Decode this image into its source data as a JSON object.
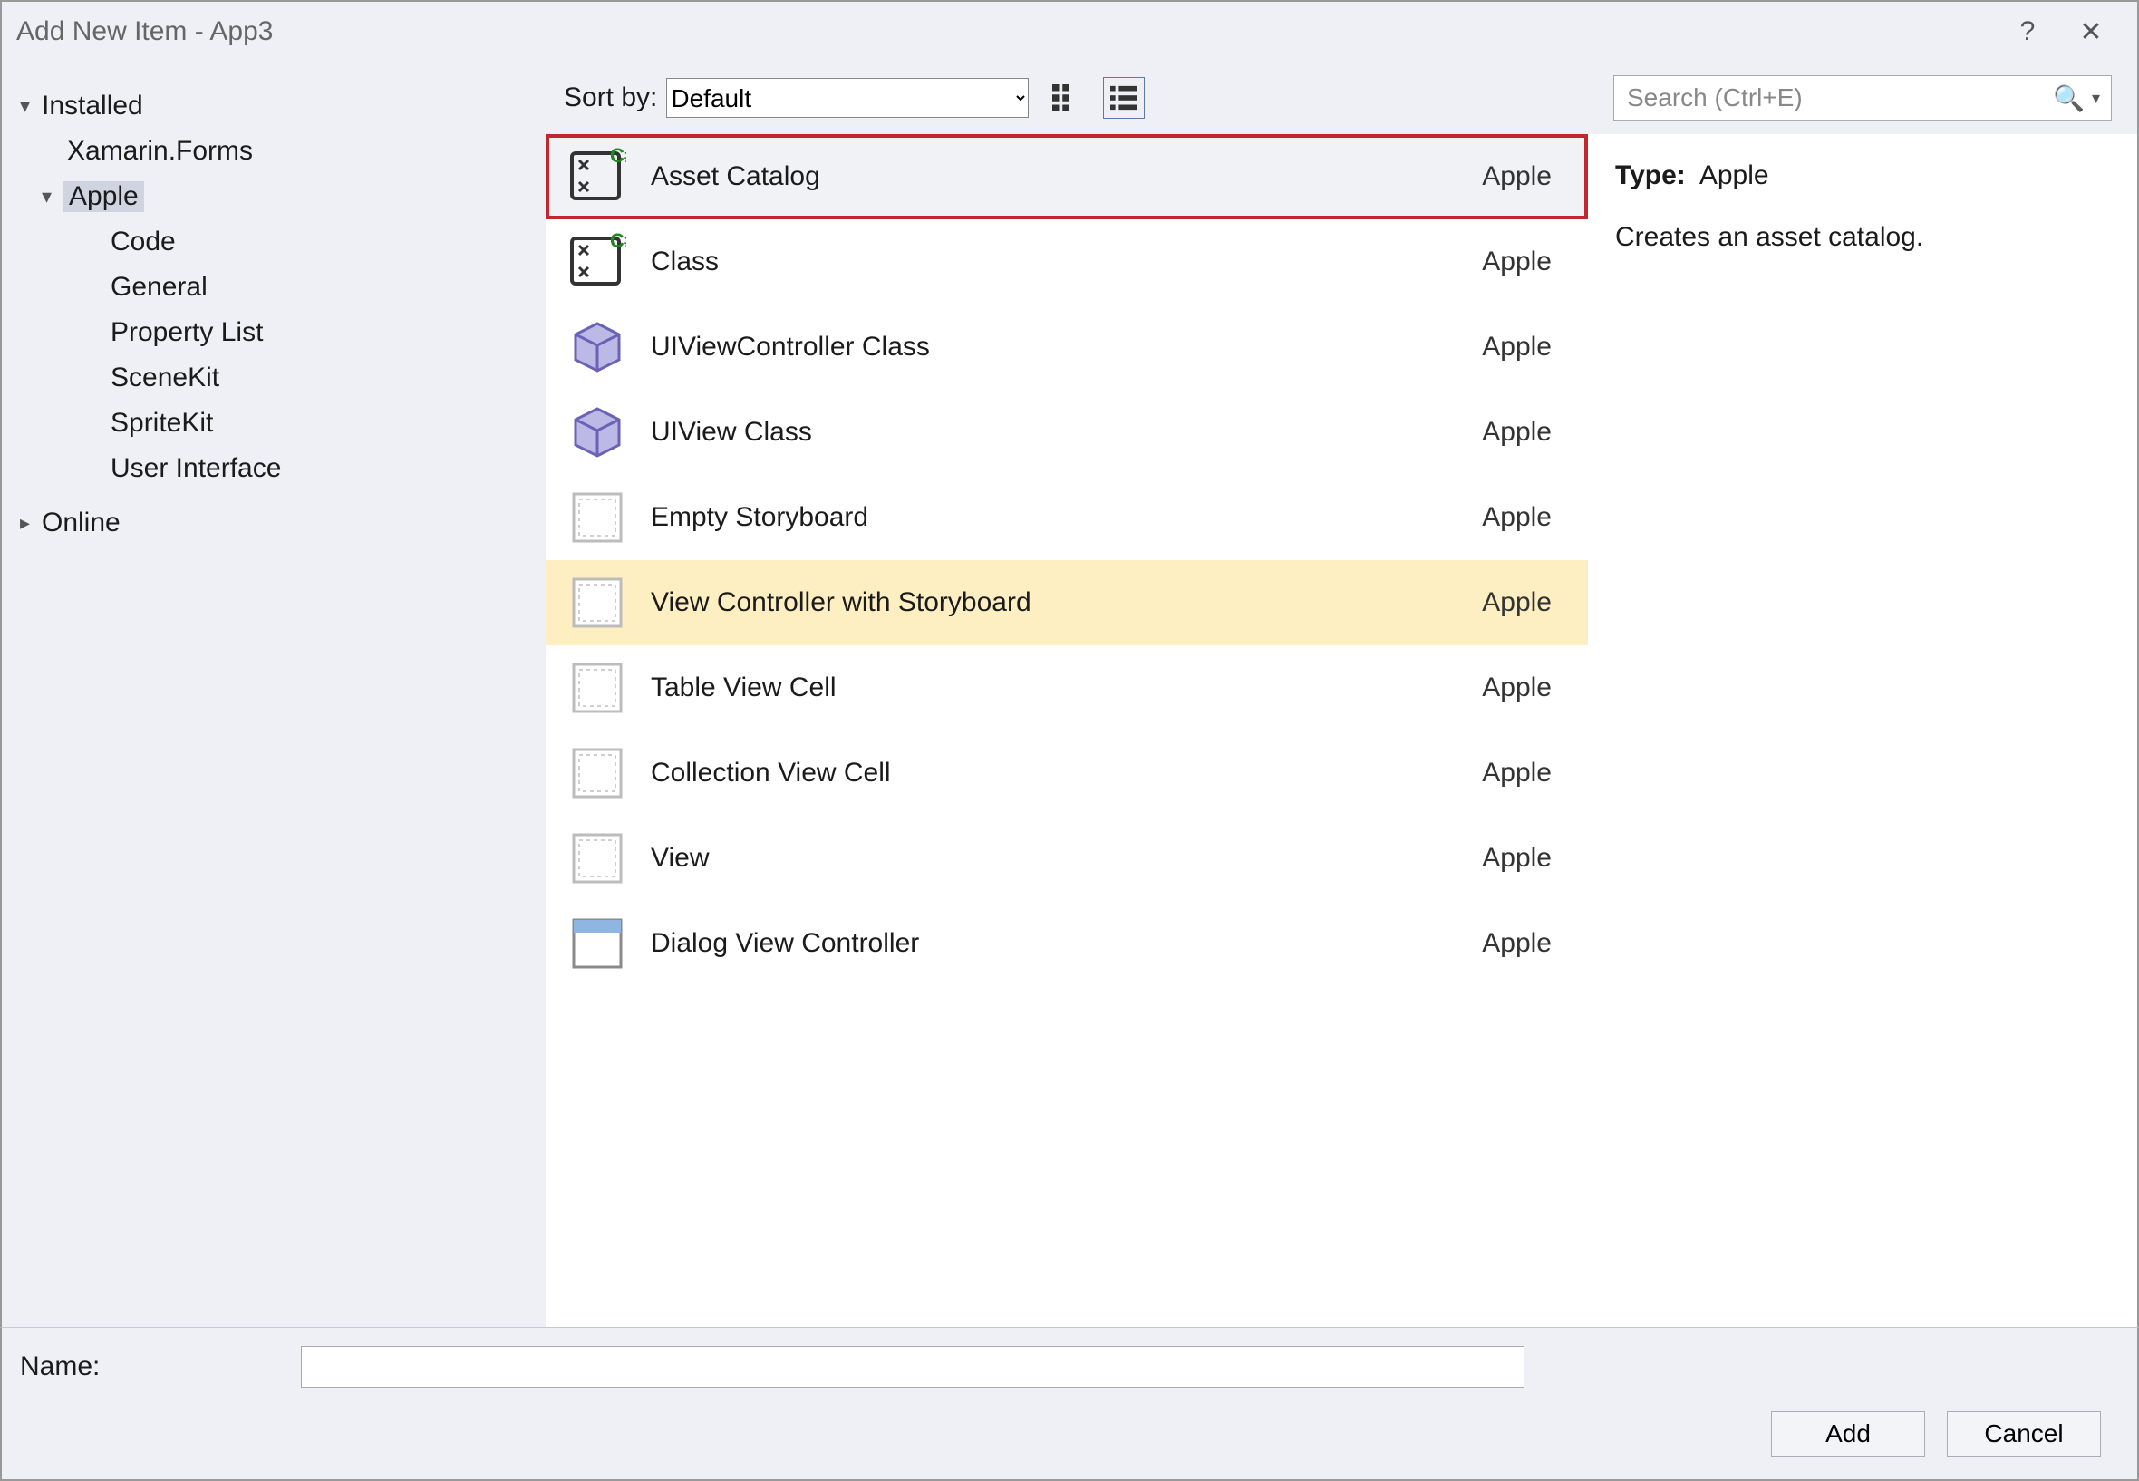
{
  "window": {
    "title": "Add New Item - App3"
  },
  "sidebar": {
    "installed_label": "Installed",
    "xamarin_forms": "Xamarin.Forms",
    "apple": "Apple",
    "apple_children": {
      "code": "Code",
      "general": "General",
      "property_list": "Property List",
      "scenekit": "SceneKit",
      "spritekit": "SpriteKit",
      "user_interface": "User Interface"
    },
    "online_label": "Online"
  },
  "toolbar": {
    "sort_label": "Sort by:",
    "sort_value": "Default"
  },
  "templates": [
    {
      "name": "Asset Catalog",
      "category": "Apple",
      "icon": "csharp",
      "state": "selected"
    },
    {
      "name": "Class",
      "category": "Apple",
      "icon": "csharp",
      "state": ""
    },
    {
      "name": "UIViewController Class",
      "category": "Apple",
      "icon": "cube",
      "state": ""
    },
    {
      "name": "UIView Class",
      "category": "Apple",
      "icon": "cube",
      "state": ""
    },
    {
      "name": "Empty Storyboard",
      "category": "Apple",
      "icon": "storyboard",
      "state": ""
    },
    {
      "name": "View Controller with Storyboard",
      "category": "Apple",
      "icon": "storyboard",
      "state": "hover"
    },
    {
      "name": "Table View Cell",
      "category": "Apple",
      "icon": "storyboard",
      "state": ""
    },
    {
      "name": "Collection View Cell",
      "category": "Apple",
      "icon": "storyboard",
      "state": ""
    },
    {
      "name": "View",
      "category": "Apple",
      "icon": "storyboard",
      "state": ""
    },
    {
      "name": "Dialog View Controller",
      "category": "Apple",
      "icon": "dialog",
      "state": ""
    }
  ],
  "search": {
    "placeholder": "Search (Ctrl+E)"
  },
  "details": {
    "type_label": "Type:",
    "type_value": "Apple",
    "description": "Creates an asset catalog."
  },
  "bottom": {
    "name_label": "Name:",
    "name_value": "",
    "add": "Add",
    "cancel": "Cancel"
  }
}
